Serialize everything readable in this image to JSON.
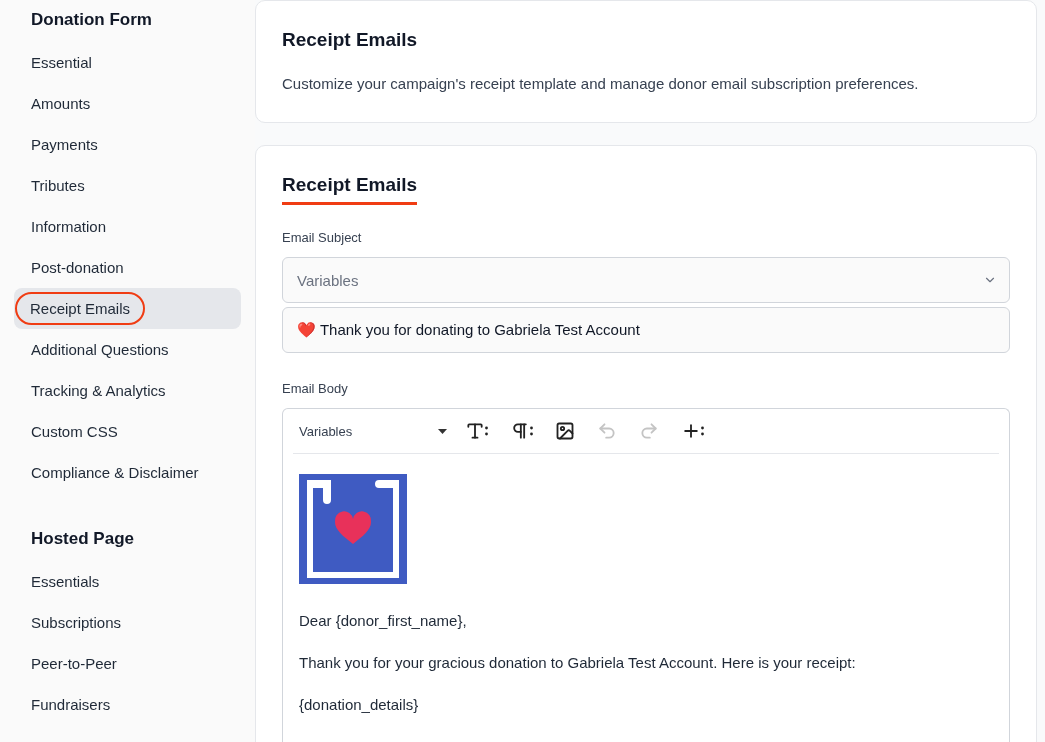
{
  "sidebar": {
    "sections": [
      {
        "title": "Donation Form",
        "items": [
          {
            "label": "Essential",
            "selected": false
          },
          {
            "label": "Amounts",
            "selected": false
          },
          {
            "label": "Payments",
            "selected": false
          },
          {
            "label": "Tributes",
            "selected": false
          },
          {
            "label": "Information",
            "selected": false
          },
          {
            "label": "Post-donation",
            "selected": false
          },
          {
            "label": "Receipt Emails",
            "selected": true
          },
          {
            "label": "Additional Questions",
            "selected": false
          },
          {
            "label": "Tracking & Analytics",
            "selected": false
          },
          {
            "label": "Custom CSS",
            "selected": false
          },
          {
            "label": "Compliance & Disclaimer",
            "selected": false
          }
        ]
      },
      {
        "title": "Hosted Page",
        "items": [
          {
            "label": "Essentials",
            "selected": false
          },
          {
            "label": "Subscriptions",
            "selected": false
          },
          {
            "label": "Peer-to-Peer",
            "selected": false
          },
          {
            "label": "Fundraisers",
            "selected": false
          }
        ]
      }
    ]
  },
  "intro_card": {
    "title": "Receipt Emails",
    "description": "Customize your campaign's receipt template and manage donor email subscription preferences."
  },
  "form_card": {
    "tab": {
      "label": "Receipt Emails",
      "selected": true
    },
    "subject": {
      "label": "Email Subject",
      "variables_placeholder": "Variables",
      "value": "❤️ Thank you for donating to Gabriela Test Account"
    },
    "body": {
      "label": "Email Body",
      "toolbar": {
        "variables": "Variables",
        "tools": [
          {
            "kind": "font",
            "disabled": false
          },
          {
            "kind": "paragraph",
            "disabled": false
          },
          {
            "kind": "image",
            "disabled": false
          },
          {
            "kind": "undo",
            "disabled": true
          },
          {
            "kind": "redo",
            "disabled": true
          },
          {
            "kind": "insert",
            "disabled": false
          }
        ]
      },
      "paragraphs": [
        "Dear {donor_first_name},",
        "Thank you for your gracious donation to Gabriela Test Account. Here is your receipt:",
        "{donation_details}"
      ]
    }
  }
}
